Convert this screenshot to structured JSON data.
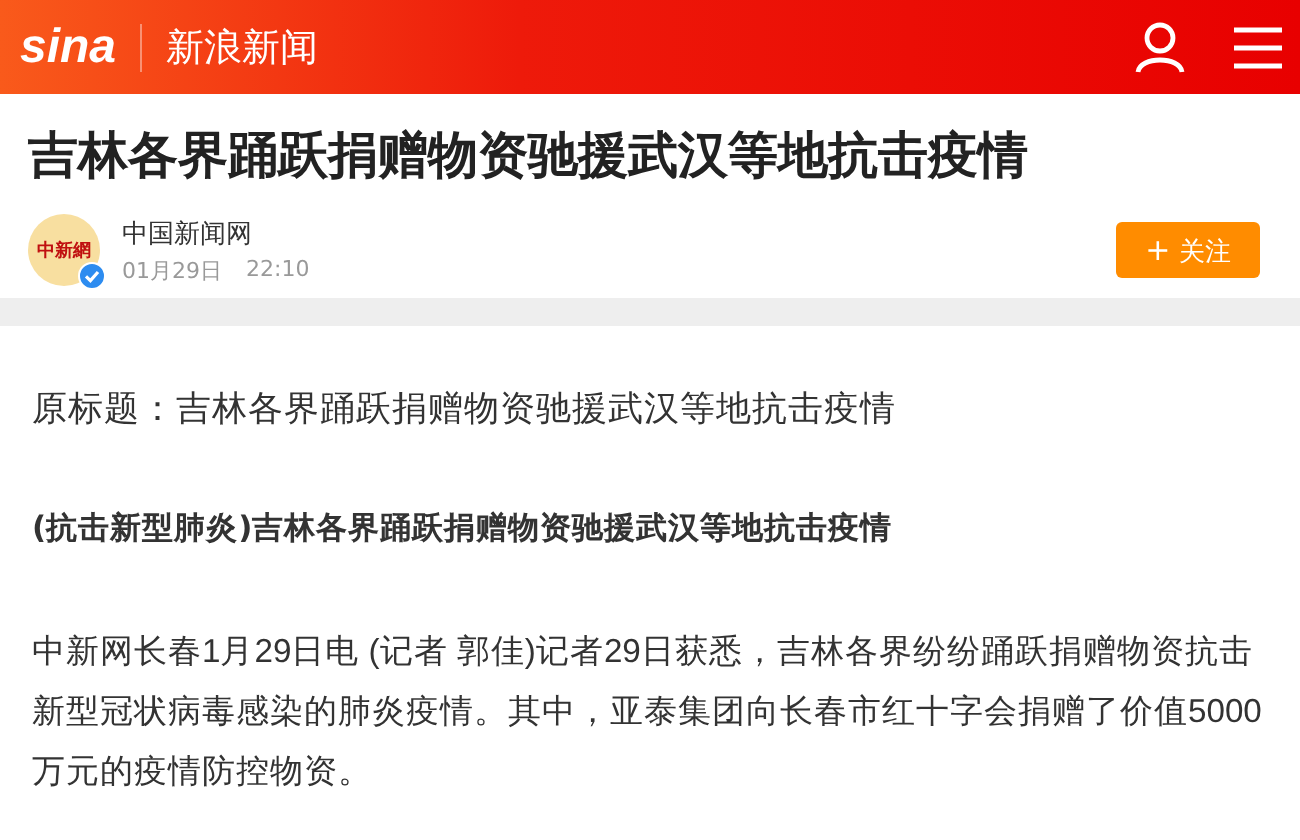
{
  "header": {
    "logo": "sina",
    "channel": "新浪新闻"
  },
  "article": {
    "title": "吉林各界踊跃捐赠物资驰援武汉等地抗击疫情",
    "author": {
      "avatar_text": "中新網",
      "name": "中国新闻网",
      "verified": true,
      "date": "01月29日",
      "time": "22:10"
    },
    "follow_button": {
      "icon": "+",
      "label": "关注"
    },
    "paragraphs": [
      {
        "kind": "plain",
        "text": "原标题：吉林各界踊跃捐赠物资驰援武汉等地抗击疫情"
      },
      {
        "kind": "heading",
        "text": "(抗击新型肺炎)吉林各界踊跃捐赠物资驰援武汉等地抗击疫情"
      },
      {
        "kind": "body",
        "text": "中新网长春1月29日电 (记者 郭佳)记者29日获悉，吉林各界纷纷踊跃捐赠物资抗击新型冠状病毒感染的肺炎疫情。其中，亚泰集团向长春市红十字会捐赠了价值5000万元的疫情防控物资。"
      }
    ]
  }
}
